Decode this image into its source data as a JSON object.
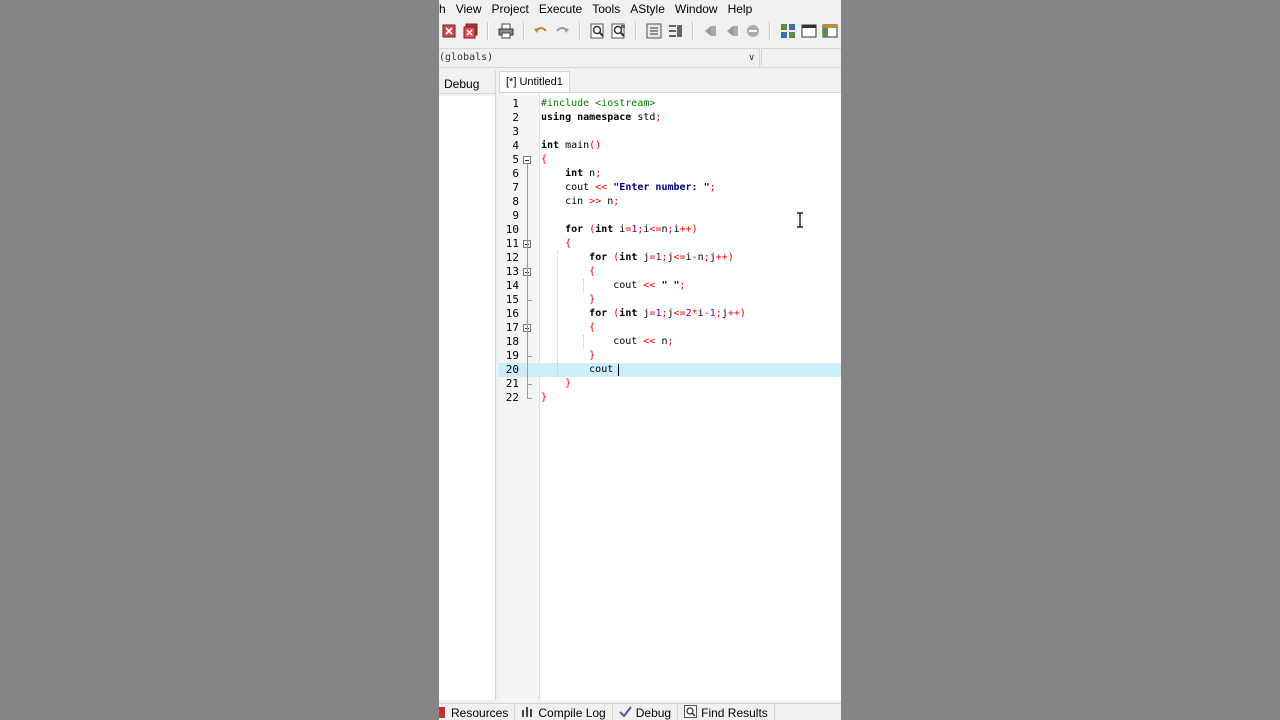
{
  "menu": [
    "h",
    "View",
    "Project",
    "Execute",
    "Tools",
    "AStyle",
    "Window",
    "Help"
  ],
  "toolbar": {
    "icons": [
      "project-close-icon",
      "project-close-all-icon",
      "print-icon",
      "undo-icon",
      "redo-icon",
      "find-icon",
      "replace-icon",
      "indent-icon",
      "unindent-icon",
      "back-icon",
      "forward-icon",
      "toggle-bookmark-icon",
      "layout-icon",
      "window-icon",
      "panel-icon"
    ]
  },
  "scope": {
    "value": "(globals)"
  },
  "left_panel": {
    "tab_label": "Debug"
  },
  "editor": {
    "tab_label": "[*] Untitled1",
    "active_line": 20,
    "lines": [
      {
        "n": "1",
        "text": "#include <iostream>"
      },
      {
        "n": "2",
        "text": "using namespace std;"
      },
      {
        "n": "3",
        "text": ""
      },
      {
        "n": "4",
        "text": "int main()"
      },
      {
        "n": "5",
        "text": "{"
      },
      {
        "n": "6",
        "text": "    int n;"
      },
      {
        "n": "7",
        "text": "    cout << \"Enter number: \";"
      },
      {
        "n": "8",
        "text": "    cin >> n;"
      },
      {
        "n": "9",
        "text": ""
      },
      {
        "n": "10",
        "text": "    for (int i=1;i<=n;i++)"
      },
      {
        "n": "11",
        "text": "    {"
      },
      {
        "n": "12",
        "text": "        for (int j=1;j<=i-n;j++)"
      },
      {
        "n": "13",
        "text": "        {"
      },
      {
        "n": "14",
        "text": "            cout << \" \";"
      },
      {
        "n": "15",
        "text": "        }"
      },
      {
        "n": "16",
        "text": "        for (int j=1;j<=2*i-1;j++)"
      },
      {
        "n": "17",
        "text": "        {"
      },
      {
        "n": "18",
        "text": "            cout << n;"
      },
      {
        "n": "19",
        "text": "        }"
      },
      {
        "n": "20",
        "text": "        cout "
      },
      {
        "n": "21",
        "text": "    }"
      },
      {
        "n": "22",
        "text": "}"
      }
    ]
  },
  "bottom_tabs": [
    {
      "label": "Resources",
      "icon": "resources-icon"
    },
    {
      "label": "Compile Log",
      "icon": "compile-log-icon"
    },
    {
      "label": "Debug",
      "icon": "debug-check-icon"
    },
    {
      "label": "Find Results",
      "icon": "find-results-icon"
    }
  ],
  "colors": {
    "keyword": "#000000",
    "preprocessor": "#008000",
    "string": "#000080",
    "symbol": "#ff0000",
    "number": "#800080",
    "active_line": "#cceefa"
  }
}
